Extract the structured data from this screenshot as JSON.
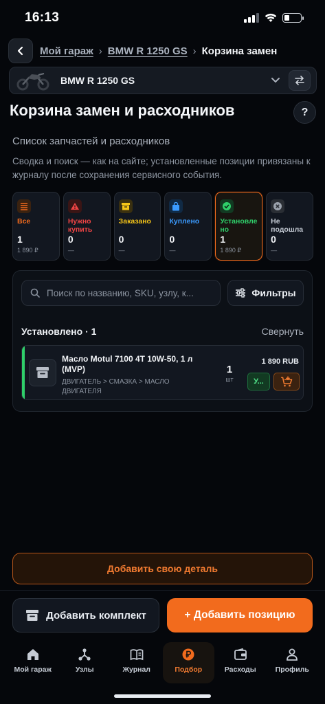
{
  "status": {
    "time": "16:13"
  },
  "breadcrumb": {
    "garage": "Мой гараж",
    "bike": "BMW R 1250 GS",
    "current": "Корзина замен"
  },
  "bike_selector": {
    "name": "BMW R 1250 GS"
  },
  "page": {
    "title": "Корзина замен и расходников",
    "help": "?",
    "subtitle": "Список запчастей и расходников",
    "description": "Сводка и поиск — как на сайте; установленные позиции привязаны к журналу после сохранения сервисного события."
  },
  "stats": [
    {
      "label": "Все",
      "count": "1",
      "sub": "1 890 ₽",
      "color": "#f26b1d",
      "icon": "list-icon"
    },
    {
      "label": "Нужно купить",
      "count": "0",
      "sub": "—",
      "color": "#ef4444",
      "icon": "warning-icon"
    },
    {
      "label": "Заказано",
      "count": "0",
      "sub": "—",
      "color": "#f5c518",
      "icon": "archive-icon"
    },
    {
      "label": "Куплено",
      "count": "0",
      "sub": "—",
      "color": "#3b9bff",
      "icon": "bag-icon"
    },
    {
      "label": "Установлено",
      "count": "1",
      "sub": "1 890 ₽",
      "color": "#2fcf6a",
      "icon": "check-circle-icon"
    },
    {
      "label": "Не подошла",
      "count": "0",
      "sub": "—",
      "color": "#9aa1ab",
      "icon": "x-circle-icon"
    }
  ],
  "search": {
    "placeholder": "Поиск по названию, SKU, узлу, к..."
  },
  "filters_label": "Фильтры",
  "section": {
    "title": "Установлено · 1",
    "collapse": "Свернуть"
  },
  "item": {
    "name": "Масло Motul 7100 4T 10W-50, 1 л (MVP)",
    "path": "ДВИГАТЕЛЬ > СМАЗКА > МАСЛО ДВИГАТЕЛЯ",
    "qty": "1",
    "unit": "шт",
    "price": "1 890 RUB",
    "status_chip": "У..."
  },
  "buttons": {
    "add_own": "Добавить свою деталь",
    "add_kit": "Добавить комплект",
    "add_position": "+ Добавить позицию"
  },
  "tabs": [
    {
      "label": "Мой гараж",
      "icon": "home-icon"
    },
    {
      "label": "Узлы",
      "icon": "nodes-icon"
    },
    {
      "label": "Журнал",
      "icon": "book-icon"
    },
    {
      "label": "Подбор",
      "icon": "ruble-badge-icon",
      "active": true
    },
    {
      "label": "Расходы",
      "icon": "wallet-icon"
    },
    {
      "label": "Профиль",
      "icon": "user-icon"
    }
  ],
  "colors": {
    "accent": "#f26b1d",
    "installed": "#2fcf6a",
    "background": "#05070b"
  }
}
